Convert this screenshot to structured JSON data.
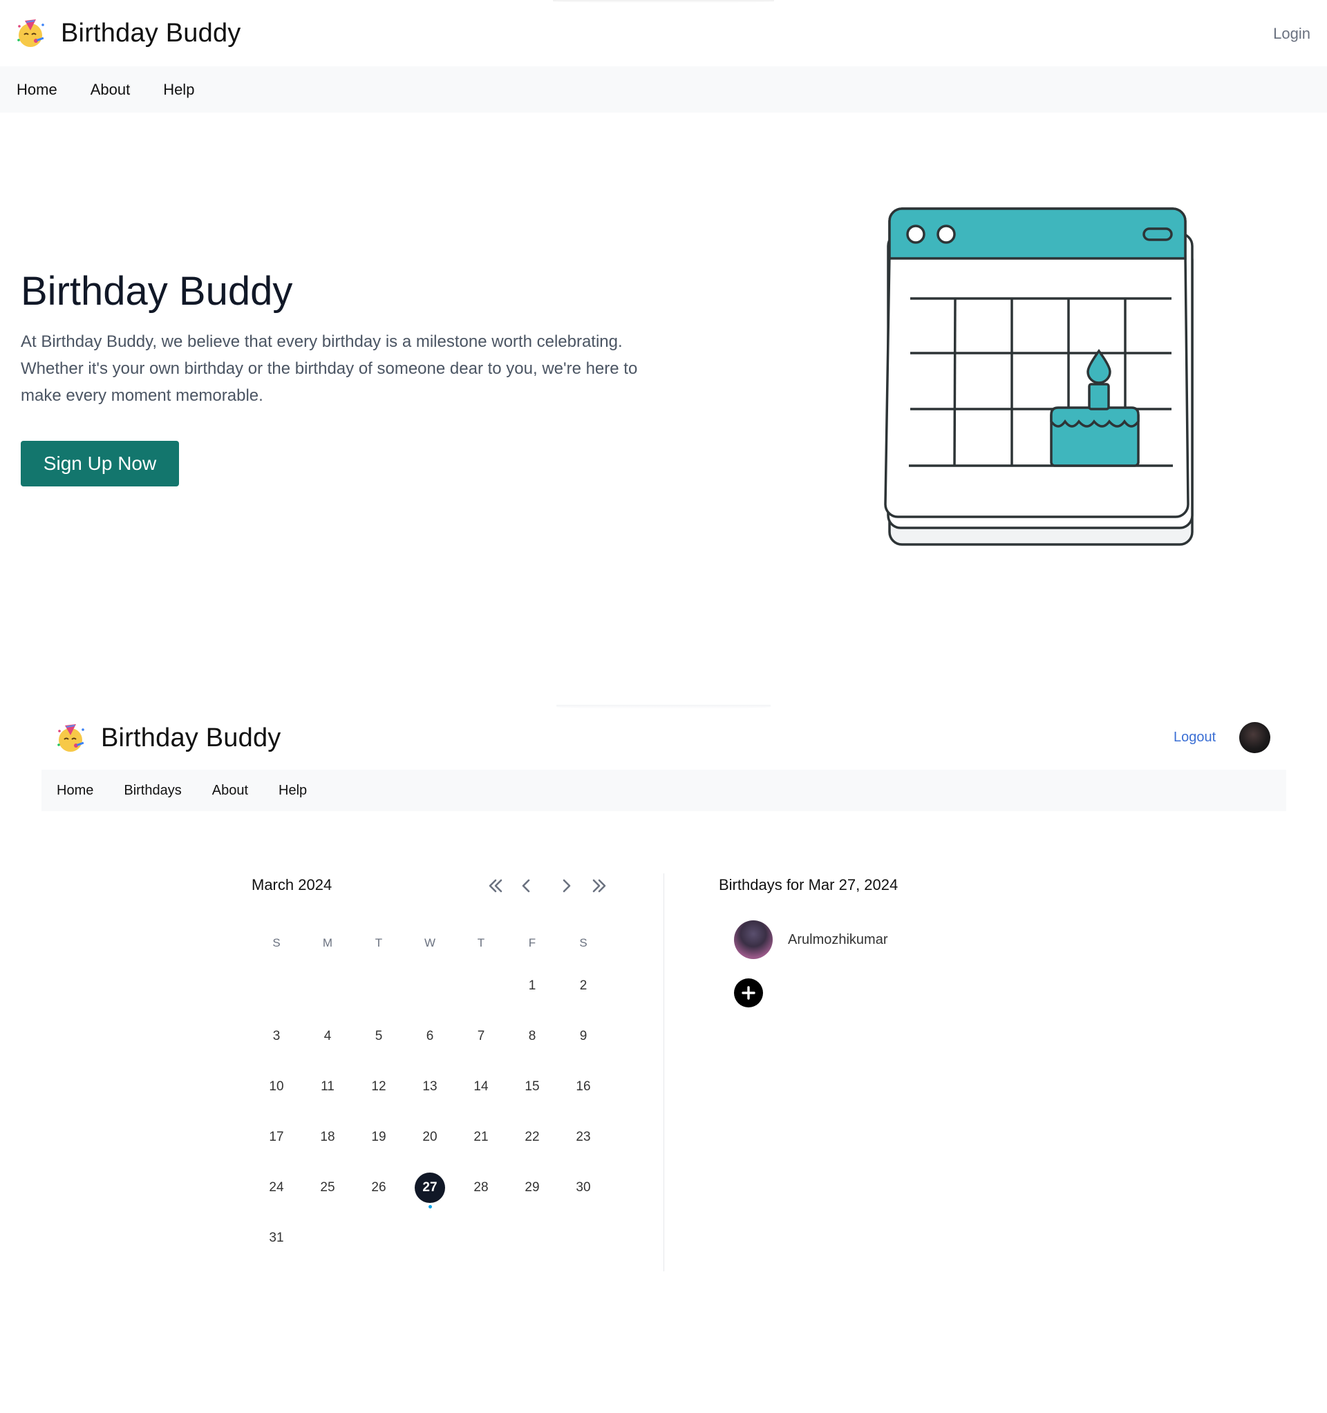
{
  "landing": {
    "brand": {
      "name": "Birthday Buddy",
      "logo_icon": "party-face-icon"
    },
    "header": {
      "login_label": "Login"
    },
    "nav": {
      "items": [
        {
          "label": "Home"
        },
        {
          "label": "About"
        },
        {
          "label": "Help"
        }
      ]
    },
    "hero": {
      "title": "Birthday Buddy",
      "description": "At Birthday Buddy, we believe that every birthday is a milestone worth celebrating. Whether it's your own birthday or the birthday of someone dear to you, we're here to make every moment memorable.",
      "cta_label": "Sign Up Now",
      "illustration_icon": "birthday-calendar-illustration"
    }
  },
  "dashboard": {
    "brand": {
      "name": "Birthday Buddy",
      "logo_icon": "party-face-icon"
    },
    "header": {
      "logout_label": "Logout",
      "avatar_icon": "user-avatar"
    },
    "nav": {
      "items": [
        {
          "label": "Home"
        },
        {
          "label": "Birthdays"
        },
        {
          "label": "About"
        },
        {
          "label": "Help"
        }
      ]
    },
    "calendar": {
      "month_label": "March 2024",
      "weekdays": [
        "S",
        "M",
        "T",
        "W",
        "T",
        "F",
        "S"
      ],
      "weeks": [
        [
          "",
          "",
          "",
          "",
          "",
          "1",
          "2"
        ],
        [
          "3",
          "4",
          "5",
          "6",
          "7",
          "8",
          "9"
        ],
        [
          "10",
          "11",
          "12",
          "13",
          "14",
          "15",
          "16"
        ],
        [
          "17",
          "18",
          "19",
          "20",
          "21",
          "22",
          "23"
        ],
        [
          "24",
          "25",
          "26",
          "27",
          "28",
          "29",
          "30"
        ],
        [
          "31",
          "",
          "",
          "",
          "",
          "",
          ""
        ]
      ],
      "selected_day": "27",
      "marked_days": [
        "27"
      ]
    },
    "birthdays": {
      "heading": "Birthdays for Mar 27, 2024",
      "items": [
        {
          "name": "Arulmozhikumar"
        }
      ]
    }
  },
  "colors": {
    "primary": "#13766d",
    "accent_teal": "#3fb6bd",
    "dark": "#111827",
    "link": "#3b6fd4",
    "nav_bg": "#f8f9fa",
    "event_dot": "#0ea5e9"
  }
}
